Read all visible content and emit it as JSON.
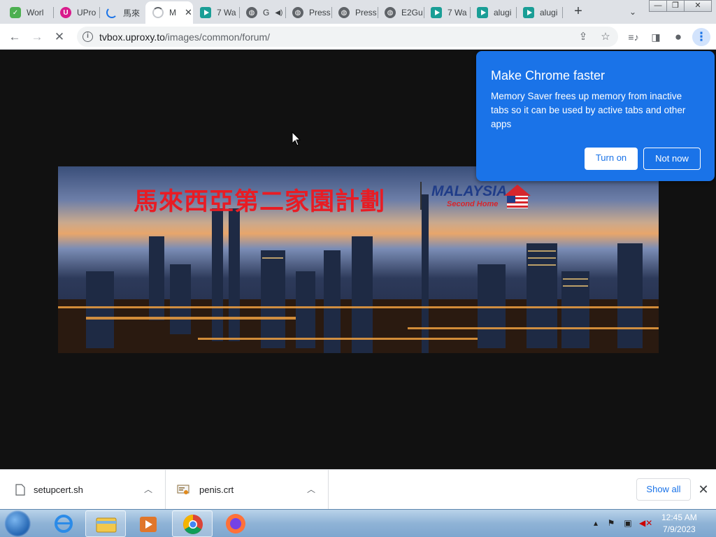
{
  "tabs": [
    {
      "title": "Worl",
      "icon": "green-shield-icon",
      "color": "#4caf50"
    },
    {
      "title": "UPro",
      "icon": "u-logo-icon",
      "color": "#d81b8c"
    },
    {
      "title": "馬來",
      "icon": "loading-icon",
      "color": "#1a73e8"
    },
    {
      "title": "M",
      "icon": "loading-spinner-icon",
      "color": "#9aa0a6",
      "active": true
    },
    {
      "title": "7 Wa",
      "icon": "play-icon"
    },
    {
      "title": "G",
      "icon": "globe-icon",
      "audio": true
    },
    {
      "title": "Press",
      "icon": "globe-icon"
    },
    {
      "title": "Press",
      "icon": "globe-icon"
    },
    {
      "title": "E2Gu",
      "icon": "globe-icon"
    },
    {
      "title": "7 Wa",
      "icon": "play-icon"
    },
    {
      "title": "alugi",
      "icon": "play-icon"
    },
    {
      "title": "alugi",
      "icon": "play-icon"
    }
  ],
  "address": {
    "host": "tvbox.uproxy.to",
    "path": "/images/common/forum/"
  },
  "banner": {
    "title": "馬來西亞第二家園計劃",
    "logo": "MALAYSIA",
    "logo_sub": "Second Home"
  },
  "popup": {
    "title": "Make Chrome faster",
    "body": "Memory Saver frees up memory from inactive tabs so it can be used by active tabs and other apps",
    "turn_on": "Turn on",
    "not_now": "Not now"
  },
  "downloads": [
    {
      "name": "setupcert.sh",
      "icon": "file-icon"
    },
    {
      "name": "penis.crt",
      "icon": "certificate-icon"
    }
  ],
  "download_bar": {
    "show_all": "Show all"
  },
  "taskbar": {
    "apps": [
      "internet-explorer-icon",
      "file-explorer-icon",
      "media-player-icon",
      "chrome-icon",
      "firefox-icon"
    ],
    "time": "12:45 AM",
    "date": "7/9/2023"
  },
  "colors": {
    "accent": "#1a73e8",
    "page_bg": "#111111"
  }
}
